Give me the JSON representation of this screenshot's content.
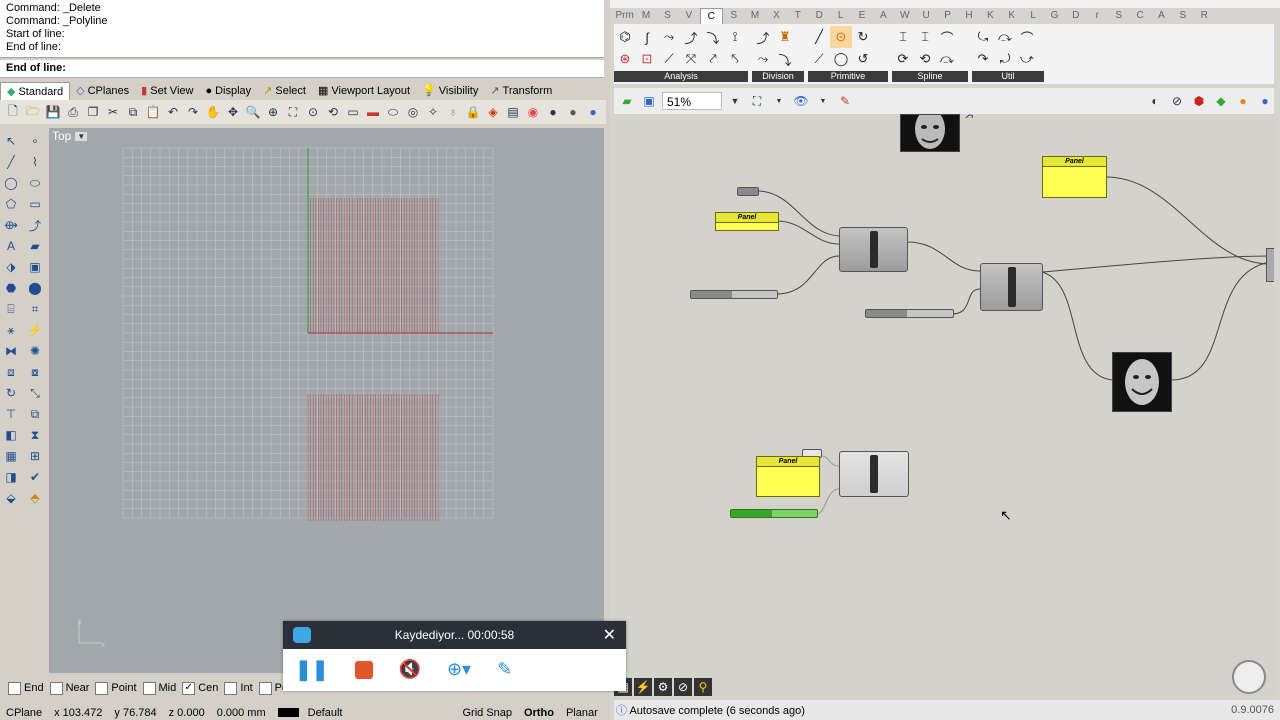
{
  "rhino": {
    "history": [
      "Command: _Delete",
      "Command: _Polyline",
      "Start of line:",
      "End of line:"
    ],
    "prompt": "End of line:",
    "tabs": [
      "Standard",
      "CPlanes",
      "Set View",
      "Display",
      "Select",
      "Viewport Layout",
      "Visibility",
      "Transform"
    ],
    "viewport_label": "Top",
    "axis_y": "y",
    "axis_x": "x",
    "snaps": [
      {
        "label": "End",
        "checked": false
      },
      {
        "label": "Near",
        "checked": false
      },
      {
        "label": "Point",
        "checked": false
      },
      {
        "label": "Mid",
        "checked": false
      },
      {
        "label": "Cen",
        "checked": true
      },
      {
        "label": "Int",
        "checked": false
      },
      {
        "label": "Per",
        "checked": false
      }
    ],
    "status": {
      "cplane": "CPlane",
      "x": "x 103.472",
      "y": "y 76.784",
      "z": "z 0.000",
      "units": "0.000 mm",
      "layer": "Default",
      "grid_snap": "Grid Snap",
      "ortho": "Ortho",
      "planar": "Planar"
    },
    "colors": {
      "viewport": "#a3a8ad",
      "grid": "#c2c6ca",
      "curves": "#b24a4a",
      "x_axis": "#b03030",
      "y_axis": "#2aa02a"
    }
  },
  "grasshopper": {
    "tabs": [
      "Prm",
      "M",
      "S",
      "V",
      "C",
      "S",
      "M",
      "X",
      "T",
      "D",
      "L",
      "E",
      "A",
      "W",
      "U",
      "P",
      "H",
      "K",
      "K",
      "L",
      "G",
      "D",
      "r",
      "S",
      "C",
      "A",
      "S",
      "R"
    ],
    "active_tab_index": 4,
    "groups": [
      "Analysis",
      "Division",
      "Primitive",
      "Spline",
      "Util"
    ],
    "zoom": "51%",
    "panel_label": "Panel",
    "autosave": "Autosave complete (6 seconds ago)",
    "version": "0.9.0076"
  },
  "recorder": {
    "title": "Kaydediyor... 00:00:58"
  }
}
